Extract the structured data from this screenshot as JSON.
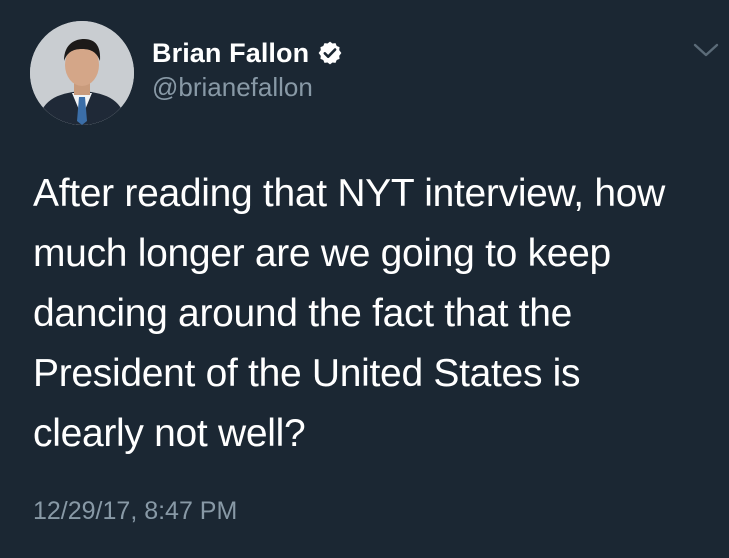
{
  "author": {
    "display_name": "Brian Fallon",
    "handle": "@brianefallon",
    "verified": true,
    "avatar_icon": "user-avatar-photo",
    "verified_icon": "verified-badge-icon"
  },
  "menu": {
    "icon": "chevron-down-icon"
  },
  "tweet": {
    "lines": [
      "After reading that NYT interview, how",
      "much longer are we going to keep",
      "dancing around the fact that the",
      "President of the United States is",
      "clearly not well?"
    ],
    "timestamp": "12/29/17, 8:47 PM"
  },
  "colors": {
    "background": "#1b2733",
    "primary_text": "#ffffff",
    "secondary_text": "#8899a6"
  }
}
